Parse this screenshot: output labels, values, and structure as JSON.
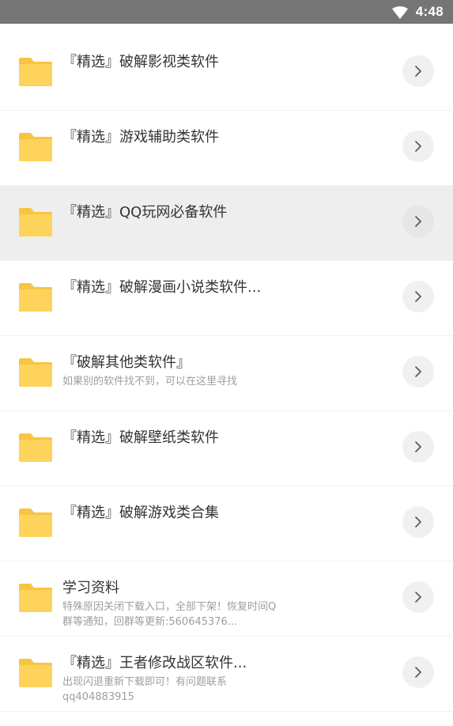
{
  "status_bar": {
    "time": "4:48",
    "wifi_icon": "wifi-icon"
  },
  "colors": {
    "folder": "#fdd35b",
    "folder_back": "#f7c443",
    "selected_row": "#eeeeee",
    "status_bar": "#757575"
  },
  "items": [
    {
      "title": "『精选』破解影视类软件",
      "desc": "",
      "desc2": "",
      "selected": false
    },
    {
      "title": "『精选』游戏辅助类软件",
      "desc": "",
      "desc2": "",
      "selected": false
    },
    {
      "title": "『精选』QQ玩网必备软件",
      "desc": "",
      "desc2": "",
      "selected": true
    },
    {
      "title": "『精选』破解漫画小说类软件...",
      "desc": "",
      "desc2": "",
      "selected": false
    },
    {
      "title": "『破解其他类软件』",
      "desc": "如果别的软件找不到，可以在这里寻找",
      "desc2": "",
      "selected": false
    },
    {
      "title": "『精选』破解壁纸类软件",
      "desc": "",
      "desc2": "",
      "selected": false
    },
    {
      "title": "『精选』破解游戏类合集",
      "desc": "",
      "desc2": "",
      "selected": false
    },
    {
      "title": "学习资料",
      "desc": "特殊原因关闭下载入口，全部下架！恢复时间Q",
      "desc2": "群等通知，回群等更新:560645376...",
      "selected": false
    },
    {
      "title": "『精选』王者修改战区软件...",
      "desc": "出现闪退重新下载即可！有问题联系",
      "desc2": "qq404883915",
      "selected": false
    }
  ]
}
